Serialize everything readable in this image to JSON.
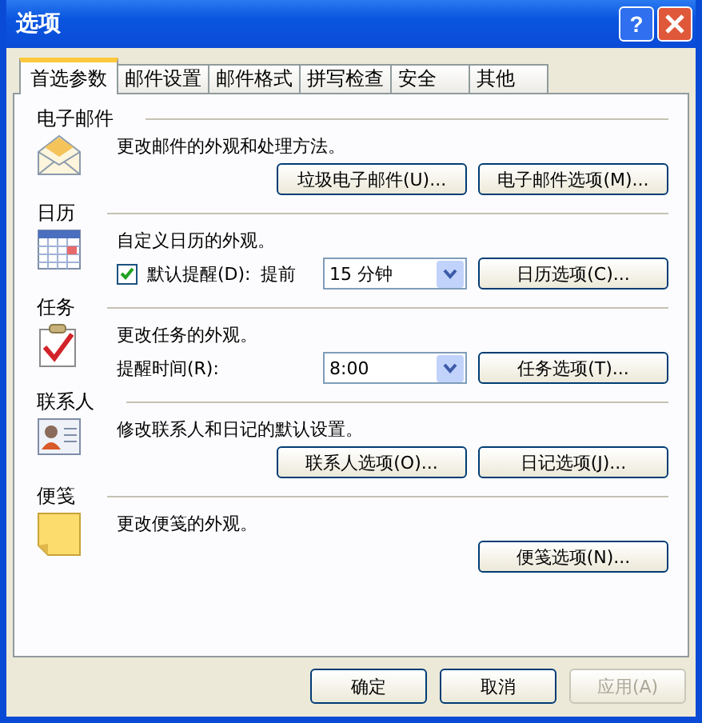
{
  "window": {
    "title": "选项",
    "help": "?"
  },
  "tabs": [
    {
      "label": "首选参数",
      "selected": true
    },
    {
      "label": "邮件设置",
      "selected": false
    },
    {
      "label": "邮件格式",
      "selected": false
    },
    {
      "label": "拼写检查",
      "selected": false
    },
    {
      "label": "安全",
      "selected": false
    },
    {
      "label": "其他",
      "selected": false
    }
  ],
  "sections": [
    {
      "title": "电子邮件",
      "kind": "envelope",
      "description": "更改邮件的外观和处理方法。",
      "rows": [
        [
          {
            "kind": "button",
            "label": "垃圾电子邮件(U)..."
          },
          {
            "kind": "button",
            "label": "电子邮件选项(M)..."
          }
        ]
      ]
    },
    {
      "title": "日历",
      "kind": "calendar",
      "description": "自定义日历的外观。",
      "rows": [
        [
          {
            "kind": "checkbox",
            "label": "默认提醒(D):",
            "checked": true
          },
          {
            "kind": "label",
            "label": "提前"
          },
          {
            "kind": "dropdown",
            "value": "15 分钟"
          },
          {
            "kind": "button",
            "label": "日历选项(C)..."
          }
        ]
      ]
    },
    {
      "title": "任务",
      "kind": "task",
      "description": "更改任务的外观。",
      "rows": [
        [
          {
            "kind": "label",
            "label": "提醒时间(R):"
          },
          {
            "kind": "dropdown",
            "value": "8:00"
          },
          {
            "kind": "button",
            "label": "任务选项(T)..."
          }
        ]
      ]
    },
    {
      "title": "联系人",
      "kind": "contact",
      "description": "修改联系人和日记的默认设置。",
      "rows": [
        [
          {
            "kind": "button",
            "label": "联系人选项(O)..."
          },
          {
            "kind": "button",
            "label": "日记选项(J)..."
          }
        ]
      ]
    },
    {
      "title": "便笺",
      "kind": "note",
      "description": "更改便笺的外观。",
      "rows": [
        [
          {
            "kind": "button",
            "label": "便笺选项(N)..."
          }
        ]
      ]
    }
  ],
  "buttons": [
    {
      "label": "确定",
      "disabled": false
    },
    {
      "label": "取消",
      "disabled": false
    },
    {
      "label": "应用(A)",
      "disabled": true
    }
  ]
}
